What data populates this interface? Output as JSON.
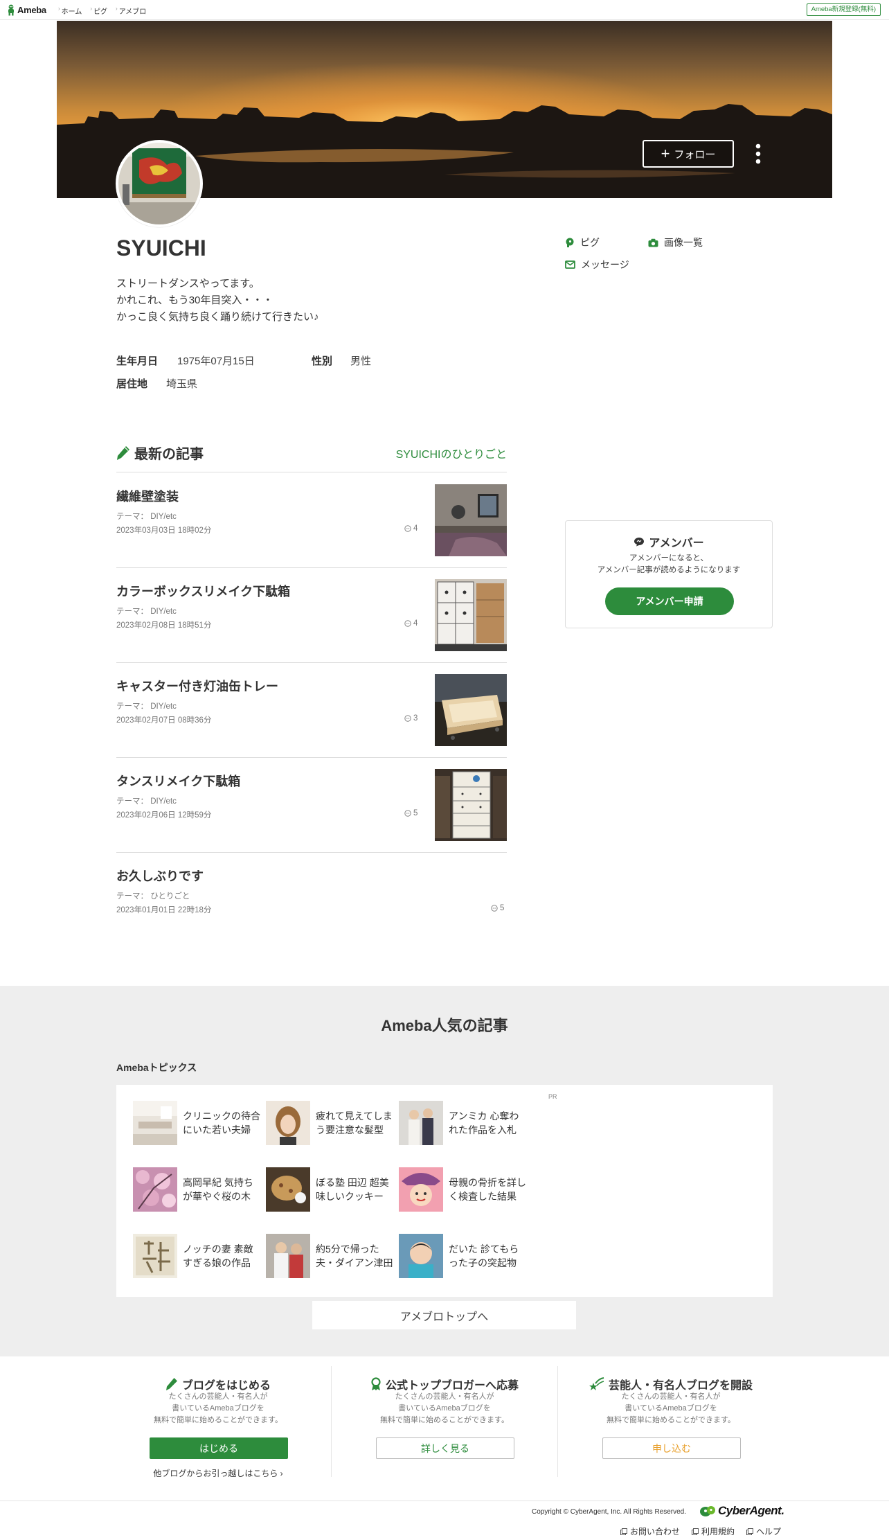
{
  "topbar": {
    "logo": "Ameba",
    "breadcrumbs": [
      "ホーム",
      "ピグ",
      "アメブロ"
    ],
    "register": "Ameba新規登録(無料)"
  },
  "header": {
    "follow_label": "フォロー"
  },
  "profile": {
    "name": "SYUICHI",
    "bio": [
      "ストリートダンスやってます。",
      "かれこれ、もう30年目突入・・・",
      "かっこ良く気持ち良く踊り続けて行きたい♪"
    ],
    "birthday_label": "生年月日",
    "birthday": "1975年07月15日",
    "gender_label": "性別",
    "gender": "男性",
    "residence_label": "居住地",
    "residence": "埼玉県"
  },
  "side_links": {
    "pigg": "ピグ",
    "images": "画像一覧",
    "message": "メッセージ"
  },
  "recent": {
    "title": "最新の記事",
    "blog_link": "SYUICHIのひとりごと",
    "articles": [
      {
        "title": "繊維壁塗装",
        "theme": "テーマ： DIY/etc",
        "date": "2023年03月03日 18時02分",
        "count": "4"
      },
      {
        "title": "カラーボックスリメイク下駄箱",
        "theme": "テーマ： DIY/etc",
        "date": "2023年02月08日 18時51分",
        "count": "4"
      },
      {
        "title": "キャスター付き灯油缶トレー",
        "theme": "テーマ： DIY/etc",
        "date": "2023年02月07日 08時36分",
        "count": "3"
      },
      {
        "title": "タンスリメイク下駄箱",
        "theme": "テーマ： DIY/etc",
        "date": "2023年02月06日 12時59分",
        "count": "5"
      },
      {
        "title": "お久しぶりです",
        "theme": "テーマ： ひとりごと",
        "date": "2023年01月01日 22時18分",
        "count": "5"
      }
    ]
  },
  "amember": {
    "title": "アメンバー",
    "desc": [
      "アメンバーになると、",
      "アメンバー記事が読めるようになります"
    ],
    "button": "アメンバー申請"
  },
  "popular": {
    "title": "Ameba人気の記事",
    "topics_label": "Amebaトピックス",
    "pr": "PR",
    "topics": [
      [
        "クリニックの待合",
        "にいた若い夫婦"
      ],
      [
        "疲れて見えてしま",
        "う要注意な髪型"
      ],
      [
        "アンミカ 心奪わ",
        "れた作品を入札"
      ],
      [
        "高岡早紀 気持ち",
        "が華やぐ桜の木"
      ],
      [
        "ぼる塾 田辺 超美",
        "味しいクッキー"
      ],
      [
        "母親の骨折を詳し",
        "く検査した結果"
      ],
      [
        "ノッチの妻 素敵",
        "すぎる娘の作品"
      ],
      [
        "約5分で帰った",
        "夫・ダイアン津田"
      ],
      [
        "だいた 診てもら",
        "った子の突起物"
      ]
    ],
    "top_button": "アメブロトップへ"
  },
  "promos": [
    {
      "title": "ブログをはじめる",
      "desc": [
        "たくさんの芸能人・有名人が",
        "書いているAmebaブログを",
        "無料で簡単に始めることができます。"
      ],
      "button": "はじめる",
      "sub": "他ブログからお引っ越しはこちら"
    },
    {
      "title": "公式トップブロガーへ応募",
      "desc": [
        "たくさんの芸能人・有名人が",
        "書いているAmebaブログを",
        "無料で簡単に始めることができます。"
      ],
      "button": "詳しく見る"
    },
    {
      "title": "芸能人・有名人ブログを開設",
      "desc": [
        "たくさんの芸能人・有名人が",
        "書いているAmebaブログを",
        "無料で簡単に始めることができます。"
      ],
      "button": "申し込む"
    }
  ],
  "footer": {
    "copyright": "Copyright © CyberAgent, Inc. All Rights Reserved.",
    "logo": "CyberAgent.",
    "links": [
      "お問い合わせ",
      "利用規約",
      "ヘルプ"
    ]
  },
  "colors": {
    "brand_green": "#2d8c3c",
    "accent_orange": "#e8a02c",
    "popular_bg": "#eeeeee"
  }
}
